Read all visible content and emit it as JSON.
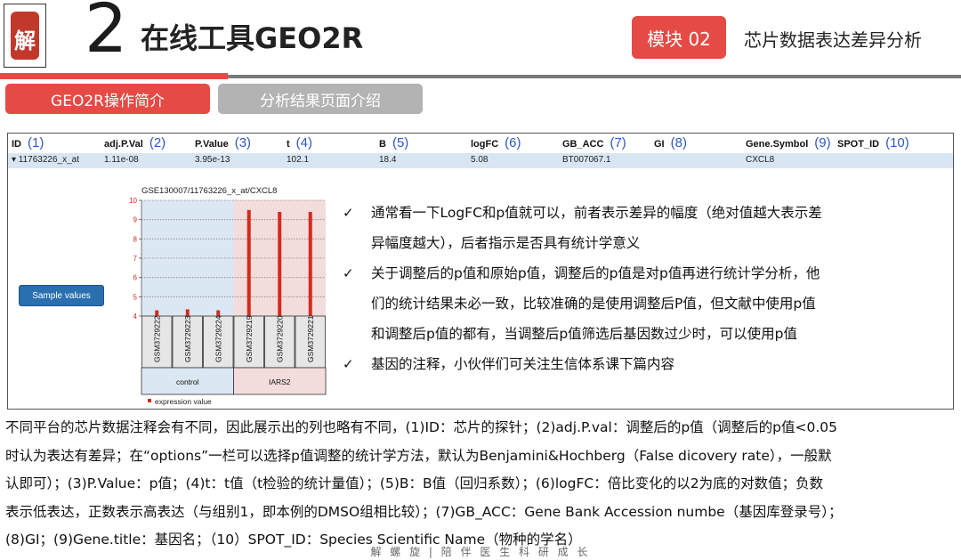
{
  "header": {
    "logo_char": "解",
    "number": "2",
    "title": "在线工具GEO2R",
    "module_badge": "模块 02",
    "module_subtitle": "芯片数据表达差异分析"
  },
  "tabs": [
    {
      "label": "GEO2R操作简介",
      "active": true
    },
    {
      "label": "分析结果页面介绍",
      "active": false
    }
  ],
  "table": {
    "columns": [
      {
        "name": "ID",
        "idx": "(1)"
      },
      {
        "name": "adj.P.Val",
        "idx": "(2)"
      },
      {
        "name": "P.Value",
        "idx": "(3)"
      },
      {
        "name": "t",
        "idx": "(4)"
      },
      {
        "name": "B",
        "idx": "(5)"
      },
      {
        "name": "logFC",
        "idx": "(6)"
      },
      {
        "name": "GB_ACC",
        "idx": "(7)"
      },
      {
        "name": "GI",
        "idx": "(8)"
      },
      {
        "name": "Gene.Symbol",
        "idx": "(9)"
      },
      {
        "name": "SPOT_ID",
        "idx": "(10)"
      }
    ],
    "row": [
      "▾ 11763226_x_at",
      "1.11e-08",
      "3.95e-13",
      "102.1",
      "18.4",
      "5.08",
      "BT007067.1",
      "",
      "CXCL8",
      ""
    ]
  },
  "sample_button": "Sample values",
  "chart_data": {
    "type": "bar",
    "title": "GSE130007/11763226_x_at/CXCL8",
    "categories": [
      "GSM3729222",
      "GSM3729223",
      "GSM3729224",
      "GSM3729219",
      "GSM3729220",
      "GSM3729221"
    ],
    "values": [
      4.3,
      4.35,
      4.3,
      9.5,
      9.4,
      9.4
    ],
    "groups": [
      {
        "name": "control",
        "members": [
          "GSM3729222",
          "GSM3729223",
          "GSM3729224"
        ],
        "color": "#dbe7f2"
      },
      {
        "name": "IARS2",
        "members": [
          "GSM3729219",
          "GSM3729220",
          "GSM3729221"
        ],
        "color": "#f3dcdc"
      }
    ],
    "ylim": [
      4,
      10
    ],
    "yticks": [
      4,
      5,
      6,
      7,
      8,
      9,
      10
    ],
    "bar_color": "#d42a1e",
    "legend": "expression value"
  },
  "bullets": [
    {
      "lines": [
        "通常看一下LogFC和p值就可以，前者表示差异的幅度（绝对值越大表示差",
        "异幅度越大），后者指示是否具有统计学意义"
      ]
    },
    {
      "lines": [
        "关于调整后的p值和原始p值，调整后的p值是对p值再进行统计学分析，他",
        "们的统计结果未必一致，比较准确的是使用调整后P值，但文献中使用p值",
        "和调整后p值的都有，当调整后p值筛选后基因数过少时，可以使用p值"
      ]
    },
    {
      "lines": [
        "基因的注释，小伙伴们可关注生信体系课下篇内容"
      ]
    }
  ],
  "paragraph": [
    "不同平台的芯片数据注释会有不同，因此展示出的列也略有不同，(1)ID：芯片的探针；(2)adj.P.val：调整后的p值（调整后的p值<0.05",
    "时认为表达有差异；在“options”一栏可以选择p值调整的统计学方法，默认为Benjamini&Hochberg（False dicovery rate），一般默",
    "认即可）；(3)P.Value：p值；(4)t：t值（t检验的统计量值）；(5)B：B值（回归系数）；(6)logFC：倍比变化的以2为底的对数值；负数",
    "表示低表达，正数表示高表达（与组别1，即本例的DMSO组相比较）；(7)GB_ACC：Gene Bank Accession numbe（基因库登录号）；",
    "(8)GI；(9)Gene.title：基因名；（10）SPOT_ID：Species Scientific Name（物种的学名）"
  ],
  "footer": "解 螺 旋   |   陪 伴 医 生 科 研 成 长"
}
